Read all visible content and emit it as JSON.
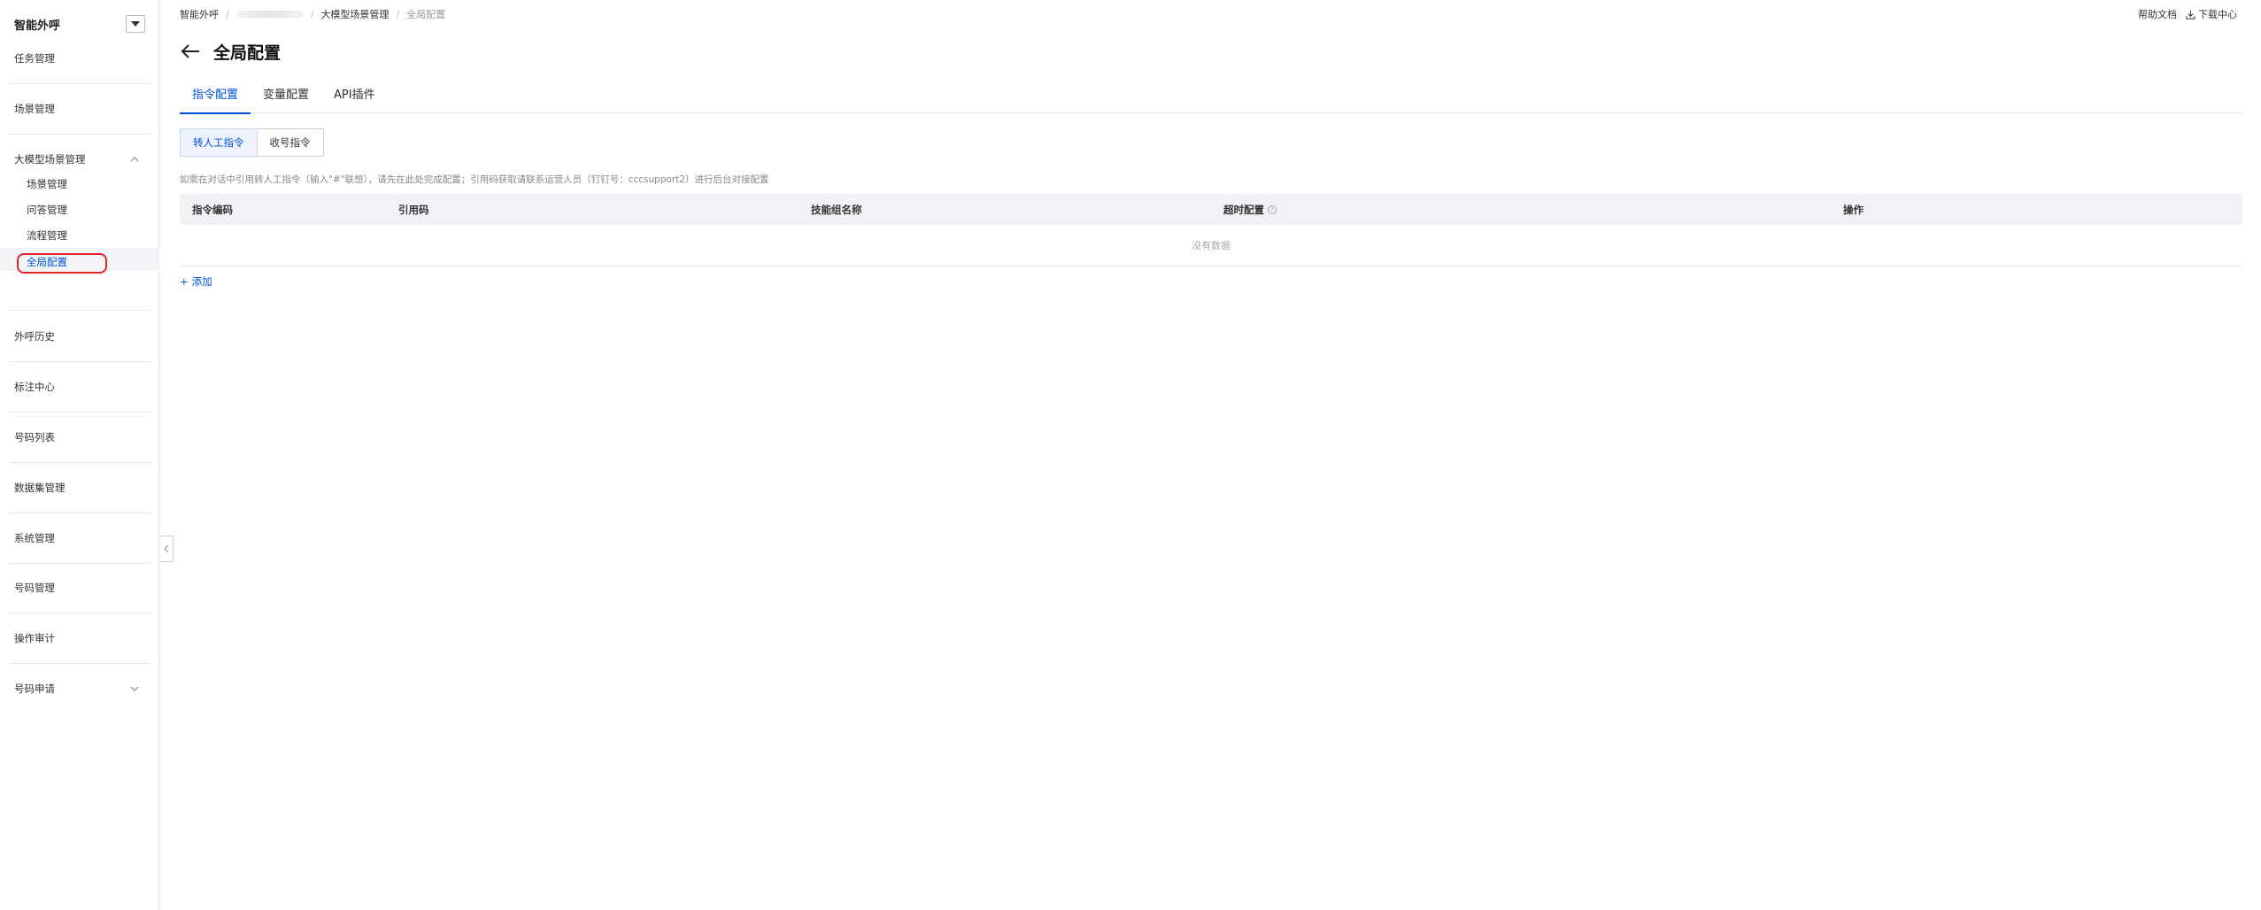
{
  "sidebar": {
    "title": "智能外呼",
    "items": {
      "task": "任务管理",
      "scene": "场景管理",
      "llm_scene": "大模型场景管理",
      "sub_scene": "场景管理",
      "sub_qa": "问答管理",
      "sub_flow": "流程管理",
      "sub_global": "全局配置",
      "history": "外呼历史",
      "annotation": "标注中心",
      "numbers": "号码列表",
      "dataset": "数据集管理",
      "system": "系统管理",
      "number_mgmt": "号码管理",
      "audit": "操作审计",
      "number_apply": "号码申请"
    }
  },
  "breadcrumb": {
    "root": "智能外呼",
    "parent": "大模型场景管理",
    "current": "全局配置"
  },
  "top_right": {
    "help": "帮助文档",
    "download": "下载中心"
  },
  "page": {
    "title": "全局配置"
  },
  "tabs": [
    "指令配置",
    "变量配置",
    "API插件"
  ],
  "segments": [
    "转人工指令",
    "收号指令"
  ],
  "hint": "如需在对话中引用转人工指令（输入\"#\"联想），请先在此处完成配置；引用码获取请联系运营人员（钉钉号：cccsupport2）进行后台对接配置",
  "table": {
    "columns": [
      "指令编码",
      "引用码",
      "技能组名称",
      "超时配置",
      "操作"
    ],
    "empty_text": "没有数据"
  },
  "add_label": "添加",
  "colors": {
    "accent": "#0052d9",
    "highlight": "#e0232a"
  }
}
